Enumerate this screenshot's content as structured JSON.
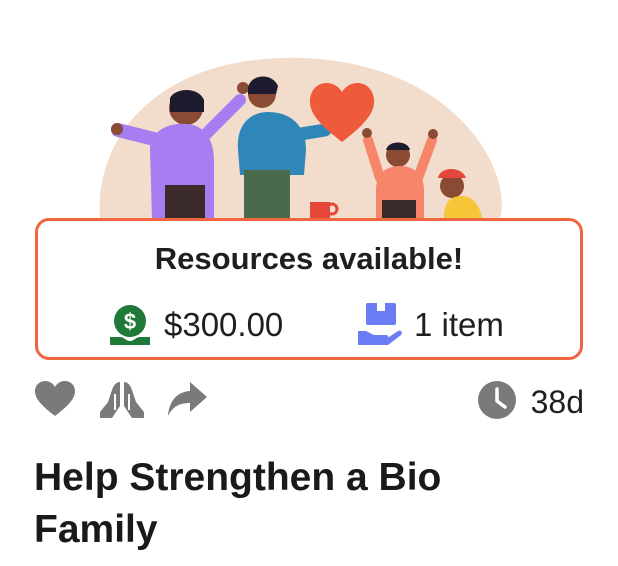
{
  "resources": {
    "heading": "Resources available!",
    "money": {
      "icon": "money-in-hand-icon",
      "amount": "$300.00",
      "color": "#1f7a3a"
    },
    "items": {
      "icon": "box-in-hand-icon",
      "count": "1 item",
      "color": "#6b7cf5"
    }
  },
  "actions": {
    "like_icon": "heart-icon",
    "pray_icon": "praying-hands-icon",
    "share_icon": "share-arrow-icon",
    "clock_icon": "clock-icon",
    "time_left": "38d"
  },
  "post": {
    "title": "Help Strengthen a Bio Family"
  },
  "colors": {
    "accent_border": "#ef6641",
    "icon_gray": "#7a7a7a",
    "blob": "#f3dcca"
  }
}
